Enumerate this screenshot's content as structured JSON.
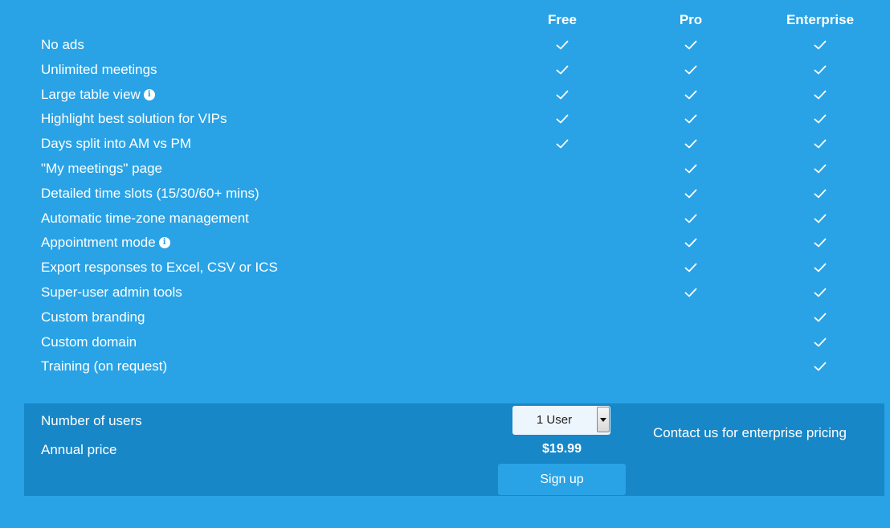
{
  "columns": [
    "Free",
    "Pro",
    "Enterprise"
  ],
  "features": [
    {
      "label": "No ads",
      "info": false,
      "plans": [
        true,
        true,
        true
      ]
    },
    {
      "label": "Unlimited meetings",
      "info": false,
      "plans": [
        true,
        true,
        true
      ]
    },
    {
      "label": "Large table view",
      "info": true,
      "plans": [
        true,
        true,
        true
      ]
    },
    {
      "label": "Highlight best solution for VIPs",
      "info": false,
      "plans": [
        true,
        true,
        true
      ]
    },
    {
      "label": "Days split into AM vs PM",
      "info": false,
      "plans": [
        true,
        true,
        true
      ]
    },
    {
      "label": "\"My meetings\" page",
      "info": false,
      "plans": [
        false,
        true,
        true
      ]
    },
    {
      "label": "Detailed time slots (15/30/60+ mins)",
      "info": false,
      "plans": [
        false,
        true,
        true
      ]
    },
    {
      "label": "Automatic time-zone management",
      "info": false,
      "plans": [
        false,
        true,
        true
      ]
    },
    {
      "label": "Appointment mode",
      "info": true,
      "plans": [
        false,
        true,
        true
      ]
    },
    {
      "label": "Export responses to Excel, CSV or ICS",
      "info": false,
      "plans": [
        false,
        true,
        true
      ]
    },
    {
      "label": "Super-user admin tools",
      "info": false,
      "plans": [
        false,
        true,
        true
      ]
    },
    {
      "label": "Custom branding",
      "info": false,
      "plans": [
        false,
        false,
        true
      ]
    },
    {
      "label": "Custom domain",
      "info": false,
      "plans": [
        false,
        false,
        true
      ]
    },
    {
      "label": "Training (on request)",
      "info": false,
      "plans": [
        false,
        false,
        true
      ]
    }
  ],
  "icons": {
    "check": "check-icon",
    "info": "info-icon",
    "dropdown": "chevron-down-icon"
  },
  "info_glyph": "i",
  "pricing": {
    "users_label": "Number of users",
    "users_value": "1 User",
    "price_label": "Annual price",
    "price_value": "$19.99",
    "signup_label": "Sign up",
    "enterprise_note": "Contact us for enterprise pricing"
  },
  "colors": {
    "background": "#29a3e6",
    "panel": "#1787c8",
    "text": "#ffffff"
  }
}
